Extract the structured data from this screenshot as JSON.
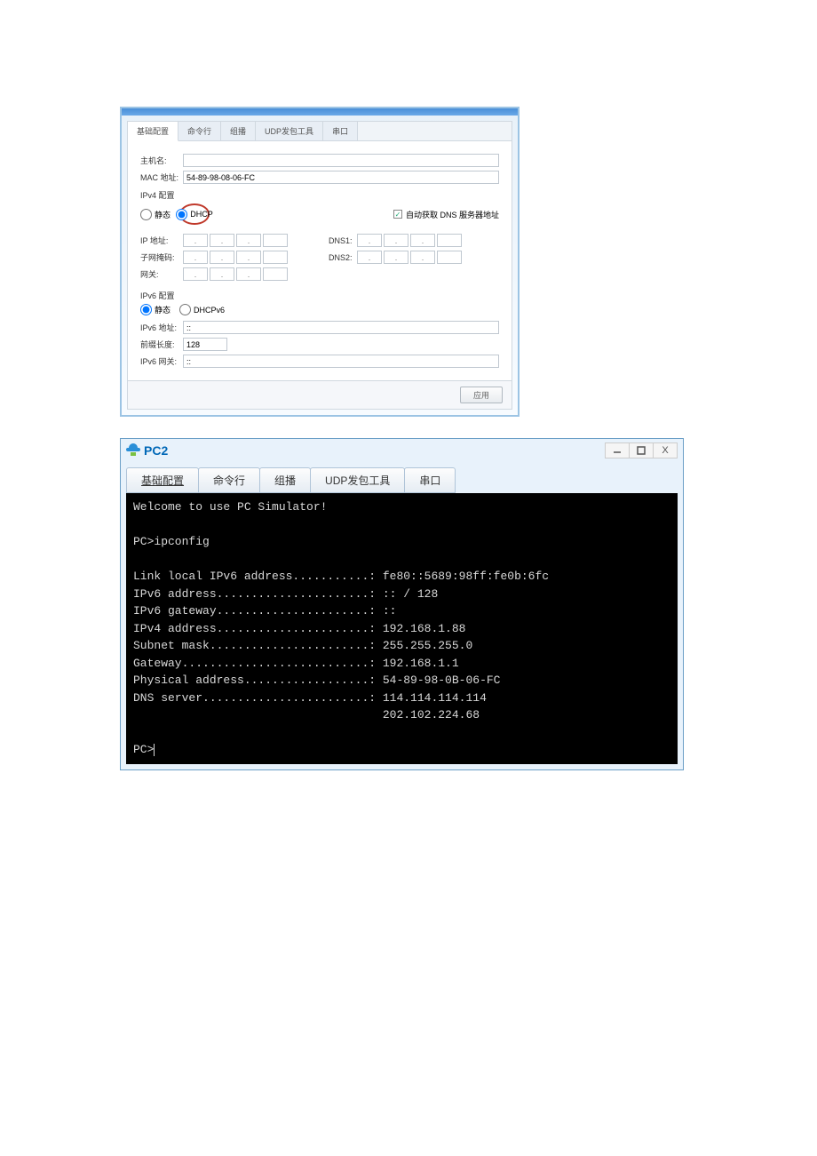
{
  "win1": {
    "tabs": [
      "基础配置",
      "命令行",
      "组播",
      "UDP发包工具",
      "串口"
    ],
    "hostname_label": "主机名:",
    "hostname_value": "",
    "mac_label": "MAC 地址:",
    "mac_value": "54-89-98-08-06-FC",
    "ipv4_section": "IPv4 配置",
    "static_label": "静态",
    "dhcp_label": "DHCP",
    "auto_dns_label": "自动获取 DNS 服务器地址",
    "ip_label": "IP 地址:",
    "mask_label": "子网掩码:",
    "gw_label": "网关:",
    "dns1_label": "DNS1:",
    "dns2_label": "DNS2:",
    "ipv6_section": "IPv6 配置",
    "static6_label": "静态",
    "dhcpv6_label": "DHCPv6",
    "ipv6_addr_label": "IPv6 地址:",
    "ipv6_addr_value": "::",
    "prefix_label": "前缀长度:",
    "prefix_value": "128",
    "ipv6_gw_label": "IPv6 网关:",
    "ipv6_gw_value": "::",
    "apply_btn": "应用"
  },
  "win2": {
    "title": "PC2",
    "tabs": [
      "基础配置",
      "命令行",
      "组播",
      "UDP发包工具",
      "串口"
    ],
    "terminal_text": "Welcome to use PC Simulator!\n\nPC>ipconfig\n\nLink local IPv6 address...........: fe80::5689:98ff:fe0b:6fc\nIPv6 address......................: :: / 128\nIPv6 gateway......................: ::\nIPv4 address......................: 192.168.1.88\nSubnet mask.......................: 255.255.255.0\nGateway...........................: 192.168.1.1\nPhysical address..................: 54-89-98-0B-06-FC\nDNS server........................: 114.114.114.114\n                                    202.102.224.68\n\nPC>"
  }
}
